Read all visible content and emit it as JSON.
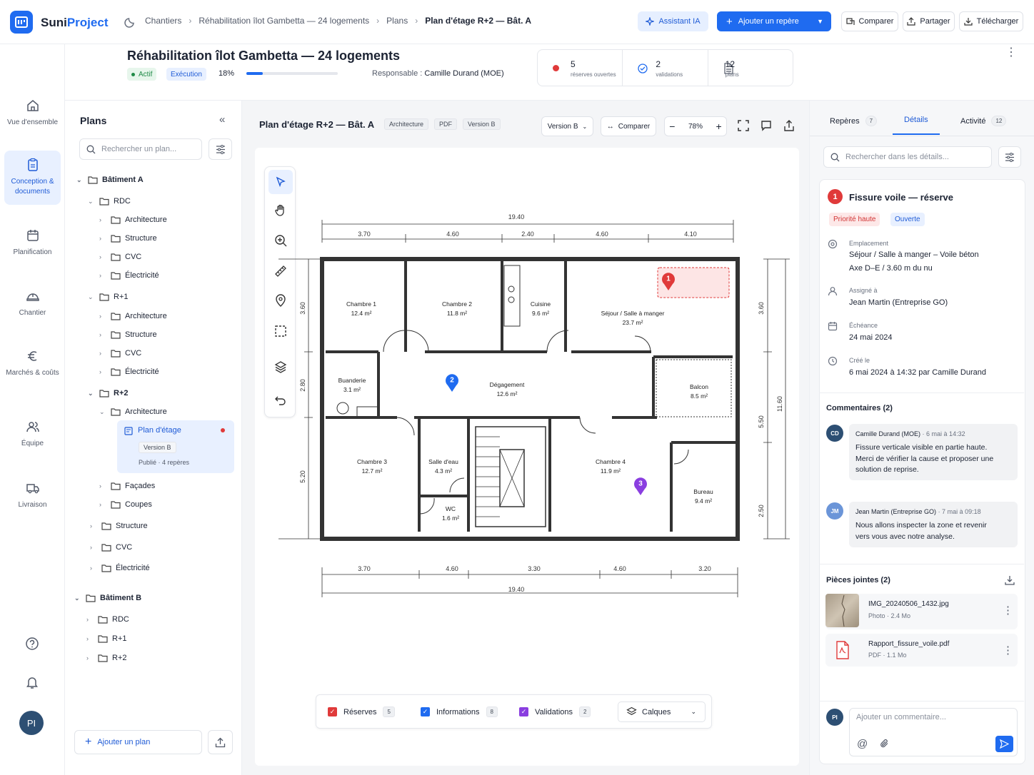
{
  "app": {
    "brand_a": "Suni",
    "brand_b": "Project"
  },
  "breadcrumb": [
    "Chantiers",
    "Réhabilitation îlot Gambetta — 24 logements",
    "Plans",
    "Plan d'étage R+2 — Bât. A"
  ],
  "toolbar": {
    "ai": "Assistant IA",
    "add_marker": "Ajouter un repère",
    "compare": "Comparer",
    "share": "Partager",
    "download": "Télécharger"
  },
  "rail": [
    "Vue d'ensemble",
    "Conception & documents",
    "Planification",
    "Chantier",
    "Marchés & coûts",
    "Équipe",
    "Livraison"
  ],
  "user_initials": "PI",
  "project": {
    "title": "Réhabilitation îlot Gambetta — 24 logements",
    "status": "Actif",
    "phase": "Exécution",
    "progress_label": "18%",
    "progress": 0.18,
    "manager_label": "Responsable :",
    "manager": "Camille Durand (MOE)",
    "stats": [
      {
        "num": "5",
        "label": "réserves ouvertes"
      },
      {
        "num": "2",
        "label": "validations"
      },
      {
        "num": "12",
        "label": "plans"
      }
    ]
  },
  "plans_panel": {
    "title": "Plans",
    "search_placeholder": "Rechercher un plan...",
    "tree": {
      "bat_a": "Bâtiment A",
      "rdc": "RDC",
      "r1": "R+1",
      "r2": "R+2",
      "architecture": "Architecture",
      "structure": "Structure",
      "cvc": "CVC",
      "electricite": "Électricité",
      "plan": "Plan d'étage",
      "plan_version": "Version B",
      "plan_status": "Publié",
      "plan_markers": "4 repères",
      "facades": "Façades",
      "coupes": "Coupes",
      "bat_b": "Bâtiment B"
    },
    "add_plan": "Ajouter un plan"
  },
  "viewer": {
    "title": "Plan d'étage R+2 — Bât. A",
    "tags": [
      "Architecture",
      "PDF",
      "Version B"
    ],
    "version": "Version B",
    "compare": "Comparer",
    "zoom": "78%",
    "rooms": [
      {
        "name": "Chambre 1",
        "area": "12.4 m²"
      },
      {
        "name": "Chambre 2",
        "area": "11.8 m²"
      },
      {
        "name": "Cuisine",
        "area": "9.6 m²"
      },
      {
        "name": "Séjour / Salle à manger",
        "area": "23.7 m²"
      },
      {
        "name": "Buanderie",
        "area": "3.1 m²"
      },
      {
        "name": "Dégagement",
        "area": "12.6 m²"
      },
      {
        "name": "Balcon",
        "area": "8.5 m²"
      },
      {
        "name": "Chambre 3",
        "area": "12.7 m²"
      },
      {
        "name": "Salle d'eau",
        "area": "4.3 m²"
      },
      {
        "name": "WC",
        "area": "1.6 m²"
      },
      {
        "name": "Chambre 4",
        "area": "11.9 m²"
      },
      {
        "name": "Bureau",
        "area": "9.4 m²"
      }
    ],
    "dims_top_total": "19.40",
    "dims_top": [
      "3.70",
      "4.60",
      "2.40",
      "4.60",
      "4.10"
    ],
    "dims_bottom": [
      "3.70",
      "4.60",
      "3.30",
      "4.60",
      "3.20"
    ],
    "dims_bottom_total": "19.40",
    "dims_left": [
      "3.60",
      "2.80",
      "5.20"
    ],
    "dims_right": [
      "3.60",
      "5.50",
      "2.50"
    ],
    "dims_right_total": "11.60",
    "markers": [
      "1",
      "2",
      "3"
    ],
    "filters": [
      {
        "label": "Réserves",
        "count": "5",
        "color": "#e03a3a"
      },
      {
        "label": "Informations",
        "count": "8",
        "color": "#1f6bf0"
      },
      {
        "label": "Validations",
        "count": "2",
        "color": "#8a3ee0"
      }
    ],
    "layers": "Calques"
  },
  "details": {
    "tabs": [
      {
        "label": "Repères",
        "count": "7"
      },
      {
        "label": "Détails",
        "count": ""
      },
      {
        "label": "Activité",
        "count": "12"
      }
    ],
    "search_placeholder": "Rechercher dans les détails...",
    "issue": {
      "number": "1",
      "title": "Fissure voile — réserve",
      "priority": "Priorité haute",
      "status": "Ouverte",
      "location_label": "Emplacement",
      "location_1": "Séjour / Salle à manger – Voile béton",
      "location_2": "Axe D–E / 3.60 m du nu",
      "assigned_label": "Assigné à",
      "assigned": "Jean Martin (Entreprise GO)",
      "due_label": "Échéance",
      "due": "24 mai 2024",
      "created_label": "Créé le",
      "created": "6 mai 2024 à 14:32 par Camille Durand"
    },
    "comments_title": "Commentaires (2)",
    "comments": [
      {
        "initials": "CD",
        "author": "Camille Durand (MOE)",
        "time": "· 6 mai à 14:32",
        "text_1": "Fissure verticale visible en partie haute.",
        "text_2": "Merci de vérifier la cause et proposer une",
        "text_3": "solution de reprise."
      },
      {
        "initials": "JM",
        "author": "Jean Martin (Entreprise GO)",
        "time": "· 7 mai à 09:18",
        "text_1": "Nous allons inspecter la zone et revenir",
        "text_2": "vers vous avec notre analyse.",
        "text_3": ""
      }
    ],
    "attachments_title": "Pièces jointes (2)",
    "attachments": [
      {
        "name": "IMG_20240506_1432.jpg",
        "meta": "Photo · 2.4 Mo"
      },
      {
        "name": "Rapport_fissure_voile.pdf",
        "meta": "PDF · 1.1 Mo"
      }
    ],
    "comment_placeholder": "Ajouter un commentaire..."
  }
}
